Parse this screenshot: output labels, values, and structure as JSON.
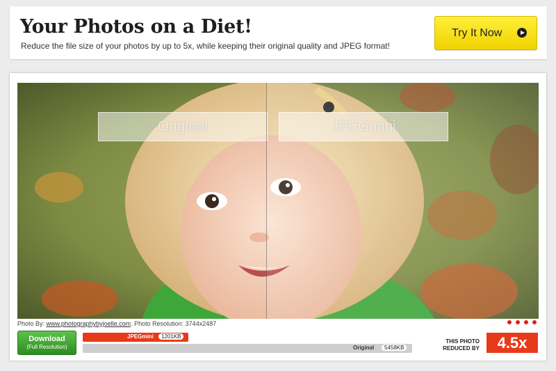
{
  "header": {
    "title": "Your Photos on a Diet!",
    "subtitle": "Reduce the file size of your photos by up to 5x, while keeping their original quality and JPEG format!",
    "cta_label": "Try It Now",
    "cta_icon": "play-circle-icon"
  },
  "comparison": {
    "left_label": "Original",
    "right_label": "JPEGmini"
  },
  "credit": {
    "prefix": "Photo By:",
    "link": "www.photographybyjoelle.com",
    "resolution": ". Photo Resolution: 3744x2487"
  },
  "carousel": {
    "count": 4,
    "color": "#e01e1e"
  },
  "download": {
    "label": "Download",
    "sub_label": "(Full Resolution)"
  },
  "sizes": {
    "jpegmini_label": "JPEGmini",
    "jpegmini_size": "1201KB",
    "original_label": "Original",
    "original_size": "5458KB",
    "jpegmini_fraction": 0.22
  },
  "reduction": {
    "label_line1": "THIS PHOTO",
    "label_line2": "REDUCED BY",
    "value": "4.5x"
  },
  "colors": {
    "accent": "#e73a1a",
    "cta": "#f7e21c",
    "download": "#3a9d2b"
  }
}
